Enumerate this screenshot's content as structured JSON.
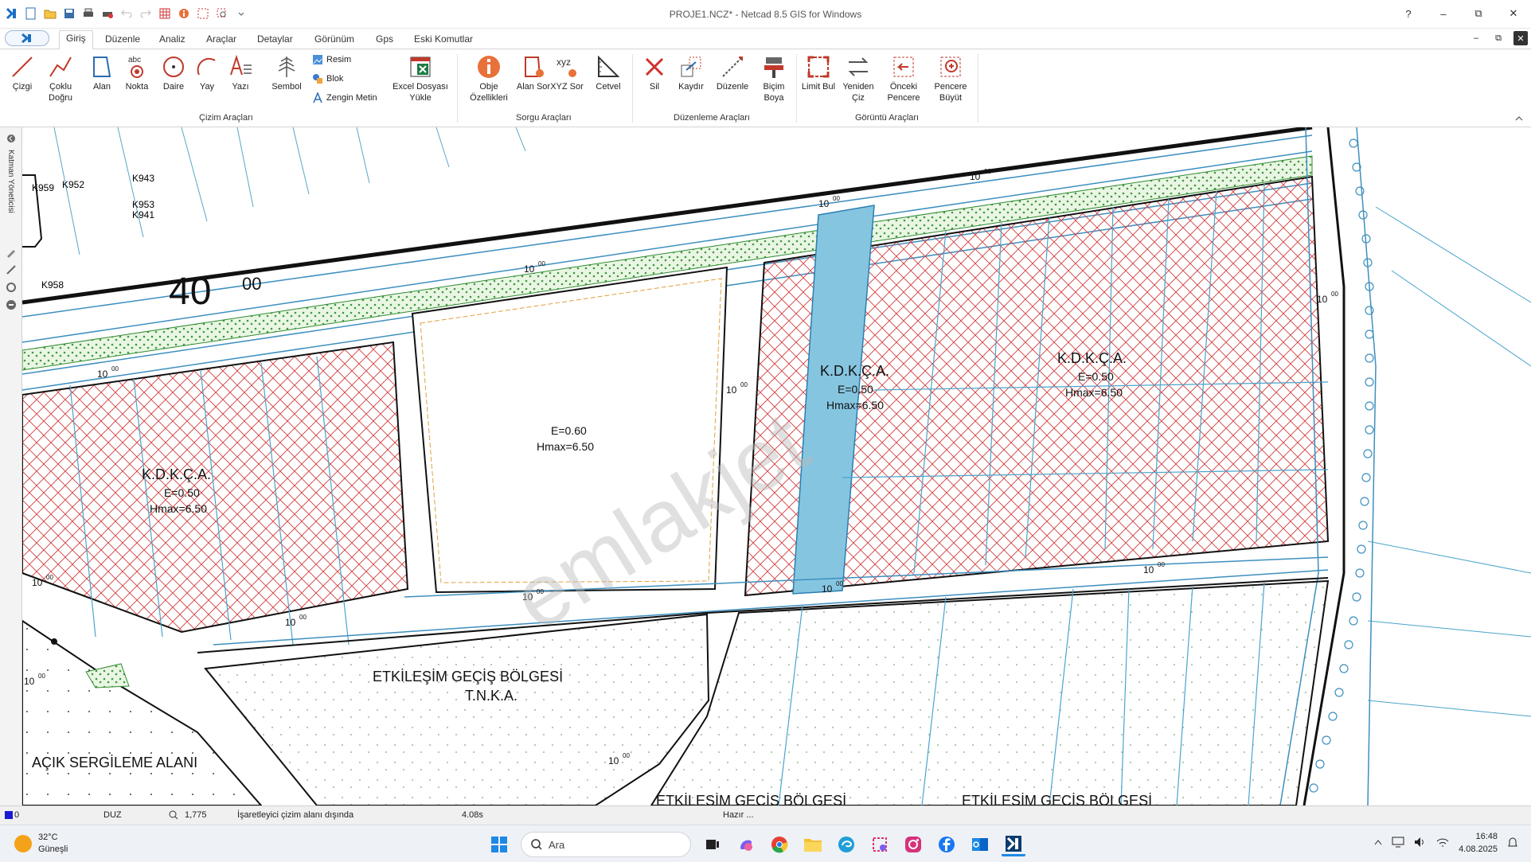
{
  "window": {
    "title": "PROJE1.NCZ* - Netcad 8.5 GIS for Windows",
    "controls": [
      "?",
      "–",
      "⧉",
      "✕"
    ]
  },
  "tabs": [
    {
      "label": "Giriş",
      "active": true
    },
    {
      "label": "Düzenle"
    },
    {
      "label": "Analiz"
    },
    {
      "label": "Araçlar"
    },
    {
      "label": "Detaylar"
    },
    {
      "label": "Görünüm"
    },
    {
      "label": "Gps"
    },
    {
      "label": "Eski Komutlar"
    }
  ],
  "ribbon": {
    "groups": {
      "cizim": "Çizim Araçları",
      "sorgu": "Sorgu Araçları",
      "duzenleme": "Düzenleme Araçları",
      "goruntu": "Görüntü Araçları"
    },
    "tools": {
      "cizgi": "Çizgi",
      "coklu_dogru": "Çoklu Doğru",
      "alan": "Alan",
      "nokta": "Nokta",
      "daire": "Daire",
      "yay": "Yay",
      "yazi": "Yazı",
      "sembol": "Sembol",
      "resim": "Resim",
      "blok": "Blok",
      "zengin_metin": "Zengin Metin",
      "excel": "Excel Dosyası Yükle",
      "obje": "Obje Özellikleri",
      "alan_sor": "Alan Sor",
      "xyz_sor": "XYZ Sor",
      "cetvel": "Cetvel",
      "sil": "Sil",
      "kaydir": "Kaydır",
      "duzenle": "Düzenle",
      "bicim_boya": "Biçim Boya",
      "limit_bul": "Limit Bul",
      "yeniden_ciz": "Yeniden Çiz",
      "onceki_pencere": "Önceki Pencere",
      "pencere_buyut": "Pencere Büyüt"
    },
    "nokta_icon_text": "abc",
    "xyz_icon_text": "xyz"
  },
  "left_panel": {
    "label": "Katman Yöneticisi"
  },
  "map": {
    "road_label": "40",
    "road_label_sup": "00",
    "zones": [
      {
        "name": "K.D.K.Ç.A.",
        "e": "E=0.50",
        "h": "Hmax=6.50"
      },
      {
        "name": "",
        "e": "E=0.60",
        "h": "Hmax=6.50"
      },
      {
        "name": "K.D.K.Ç.A.",
        "e": "E=0.50",
        "h": "Hmax=6.50"
      },
      {
        "name": "K.D.K.Ç.A.",
        "e": "E=0.50",
        "h": "Hmax=6.50"
      }
    ],
    "etkilesim": "ETKİLEŞİM GEÇİŞ BÖLGESİ",
    "tnka": "T.N.K.A.",
    "acik": "AÇIK SERGİLEME ALANI",
    "bottom_cut_1": "ETKİLEŞİM GEÇİŞ BÖLGESİ",
    "bottom_cut_2": "ETKİLEŞİM GEÇİŞ BÖLGESİ",
    "watermark": "emlakjet",
    "k_labels": [
      "K959",
      "K952",
      "K943",
      "K953",
      "K941",
      "K958"
    ],
    "ten": "10",
    "ten_sup": "00"
  },
  "status": {
    "layer": "0",
    "mode": "DUZ",
    "zoom": "1,775",
    "msg": "İşaretleyici çizim alanı dışında",
    "time": "4.08s",
    "ready": "Hazır ..."
  },
  "taskbar": {
    "temp": "32°C",
    "weather": "Güneşli",
    "search_placeholder": "Ara",
    "time": "16:48",
    "date": "4.08.2025"
  }
}
